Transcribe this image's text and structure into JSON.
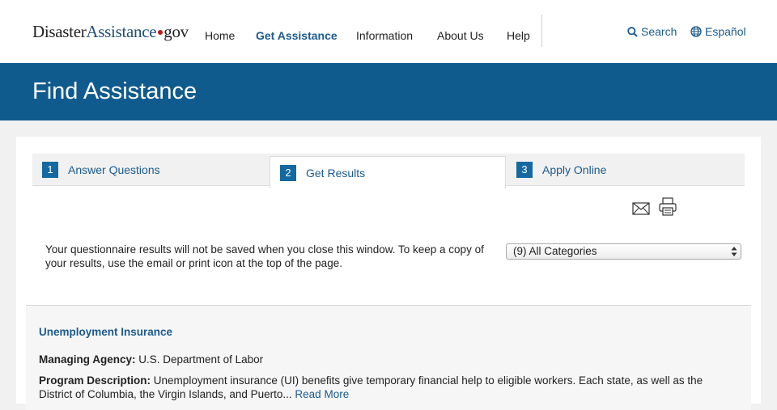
{
  "logo": {
    "part1": "Disaster",
    "part2": "Assistance",
    "part3": "gov"
  },
  "nav": [
    {
      "label": "Home",
      "active": false
    },
    {
      "label": "Get Assistance",
      "active": true
    },
    {
      "label": "Information",
      "active": false
    },
    {
      "label": "About Us",
      "active": false
    },
    {
      "label": "Help",
      "active": false
    }
  ],
  "utility": {
    "search": "Search",
    "language": "Español"
  },
  "banner": {
    "title": "Find Assistance"
  },
  "steps": [
    {
      "num": "1",
      "label": "Answer Questions"
    },
    {
      "num": "2",
      "label": "Get Results"
    },
    {
      "num": "3",
      "label": "Apply Online"
    }
  ],
  "current_step": 2,
  "notice": "Your questionnaire results will not be saved when you close this window. To keep a copy of your results, use the email or print icon at the top of the page.",
  "category_select": {
    "value": "(9) All Categories"
  },
  "program": {
    "title": "Unemployment Insurance",
    "agency_label": "Managing Agency:",
    "agency_value": "U.S. Department of Labor",
    "description_label": "Program Description:",
    "description_value": "Unemployment insurance (UI) benefits give temporary financial help to eligible workers. Each state, as well as the District of Columbia, the Virgin Islands, and Puerto...",
    "read_more": "Read More"
  },
  "colors": {
    "banner": "#105b8e",
    "link": "#1a5a8e",
    "step_badge": "#1469a1",
    "logo_dot": "#c4161c"
  }
}
